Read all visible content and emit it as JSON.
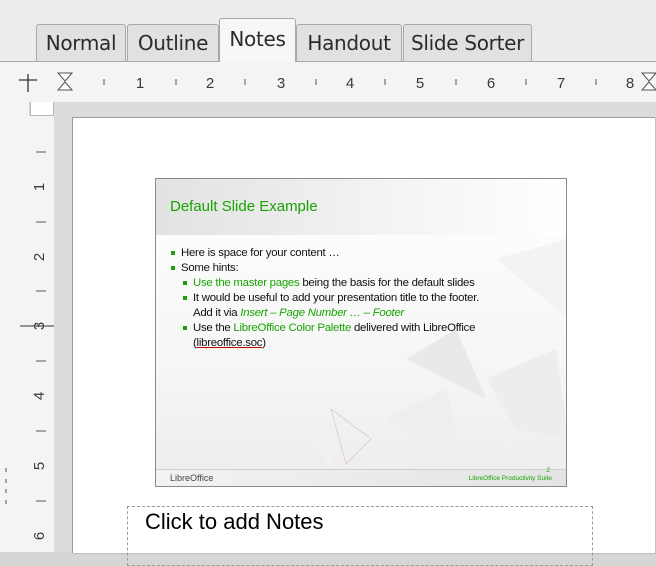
{
  "tabs": [
    {
      "label": "Normal",
      "active": false
    },
    {
      "label": "Outline",
      "active": false
    },
    {
      "label": "Notes",
      "active": true
    },
    {
      "label": "Handout",
      "active": false
    },
    {
      "label": "Slide Sorter",
      "active": false
    }
  ],
  "ruler": {
    "horizontal_numbers": [
      "1",
      "2",
      "3",
      "4",
      "5",
      "6",
      "7",
      "8"
    ],
    "vertical_numbers": [
      "1",
      "2",
      "3",
      "4",
      "5",
      "6"
    ]
  },
  "slide": {
    "title": "Default Slide Example",
    "bullet_1": "Here is space for your content …",
    "bullet_2": "Some hints:",
    "hint_1_link": "Use the master pages",
    "hint_1_rest": " being the basis for the default slides",
    "hint_2_line1": "It would be useful to add your presentation title to the footer.",
    "hint_2_prefix": "Add it via ",
    "hint_2_path": "Insert – Page Number … – Footer",
    "hint_3_prefix": "Use the ",
    "hint_3_link": "LibreOffice Color Palette",
    "hint_3_rest": " delivered with LibreOffice",
    "hint_3_paren_open": "(",
    "hint_3_url": "libreoffice.soc",
    "hint_3_paren_close": ")",
    "footer_logo": "LibreOffice",
    "footer_right": "LibreOffice Productivity Suite",
    "page_number": "2"
  },
  "notes": {
    "placeholder": "Click to add Notes"
  },
  "colors": {
    "accent_green": "#18a303",
    "tab_active": "#f7f7f7",
    "tab_inactive": "#e1e1e1"
  }
}
